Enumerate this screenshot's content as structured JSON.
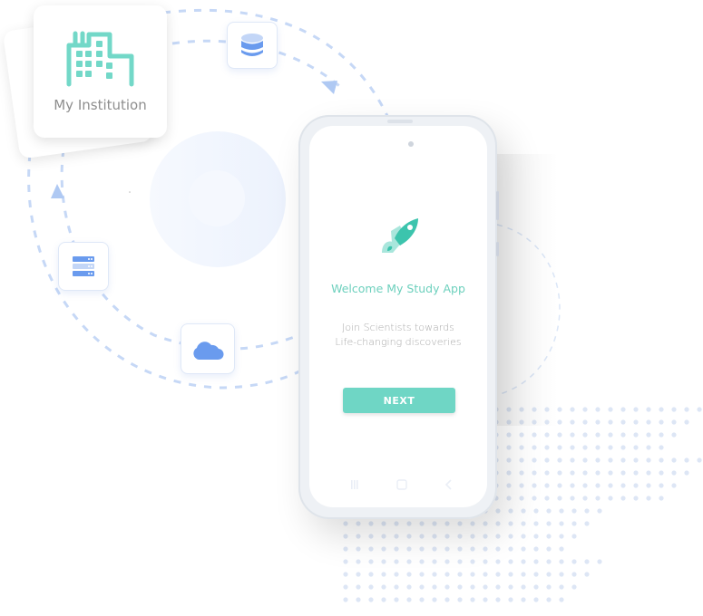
{
  "institution_card": {
    "label": "My Institution",
    "icon": "building-icon"
  },
  "floating_icons": [
    {
      "name": "database-icon"
    },
    {
      "name": "server-icon"
    },
    {
      "name": "cloud-icon"
    }
  ],
  "phone": {
    "app_icon": "rocket-icon",
    "welcome_title": "Welcome My Study App",
    "tagline_line1": "Join Scientists towards",
    "tagline_line2": "Life-changing discoveries",
    "next_button": "NEXT",
    "nav_bar": [
      "recent-apps-icon",
      "home-icon",
      "back-icon"
    ]
  },
  "colors": {
    "accent_teal": "#6fd6c5",
    "rocket_teal": "#3cc4ad",
    "icon_blue": "#6a9bee",
    "dash_blue": "#c6d8f6",
    "dot_blue": "#dde6f5"
  }
}
